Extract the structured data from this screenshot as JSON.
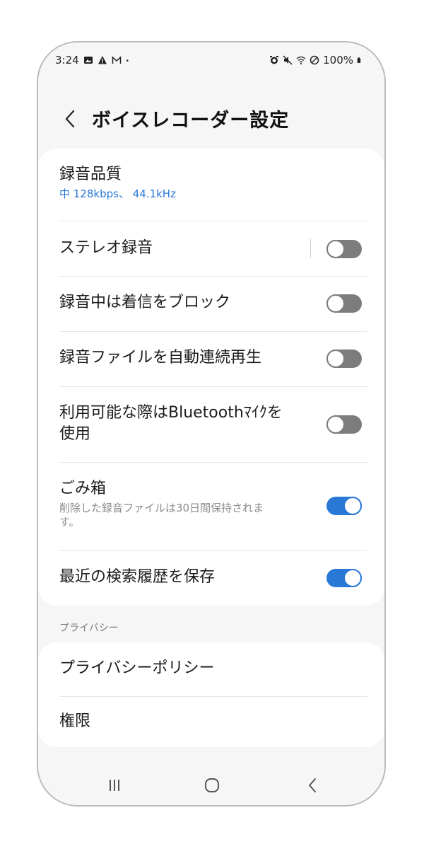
{
  "status_bar": {
    "time": "3:24",
    "left_icons": [
      "gallery-icon",
      "warning-icon",
      "mail-icon",
      "dot-icon"
    ],
    "right_icons": [
      "alarm-icon",
      "mute-icon",
      "wifi-icon",
      "dnd-icon"
    ],
    "battery": "100%"
  },
  "header": {
    "title": "ボイスレコーダー設定"
  },
  "settings": {
    "recording_quality": {
      "label": "録音品質",
      "value": "中 128kbps、 44.1kHz"
    },
    "stereo": {
      "label": "ステレオ録音",
      "enabled": false
    },
    "block_calls": {
      "label": "録音中は着信をブロック",
      "enabled": false
    },
    "autoplay": {
      "label": "録音ファイルを自動連続再生",
      "enabled": false
    },
    "bluetooth_mic": {
      "label_line1": "利用可能な際はBluetoothﾏｲｸを",
      "label_line2": "使用",
      "enabled": false
    },
    "trash": {
      "label": "ごみ箱",
      "desc_line1": "削除した録音ファイルは30日間保持されま",
      "desc_line2": "す。",
      "enabled": true
    },
    "search_history": {
      "label": "最近の検索履歴を保存",
      "enabled": true
    }
  },
  "privacy": {
    "section_label": "プライバシー",
    "policy": "プライバシーポリシー",
    "permissions": "権限"
  },
  "navigation": [
    "recent-apps-button",
    "home-button",
    "back-button"
  ],
  "colors": {
    "accent": "#2a78d6",
    "toggle_off": "#7c7c7c",
    "background": "#f6f6f6",
    "card": "#ffffff"
  }
}
